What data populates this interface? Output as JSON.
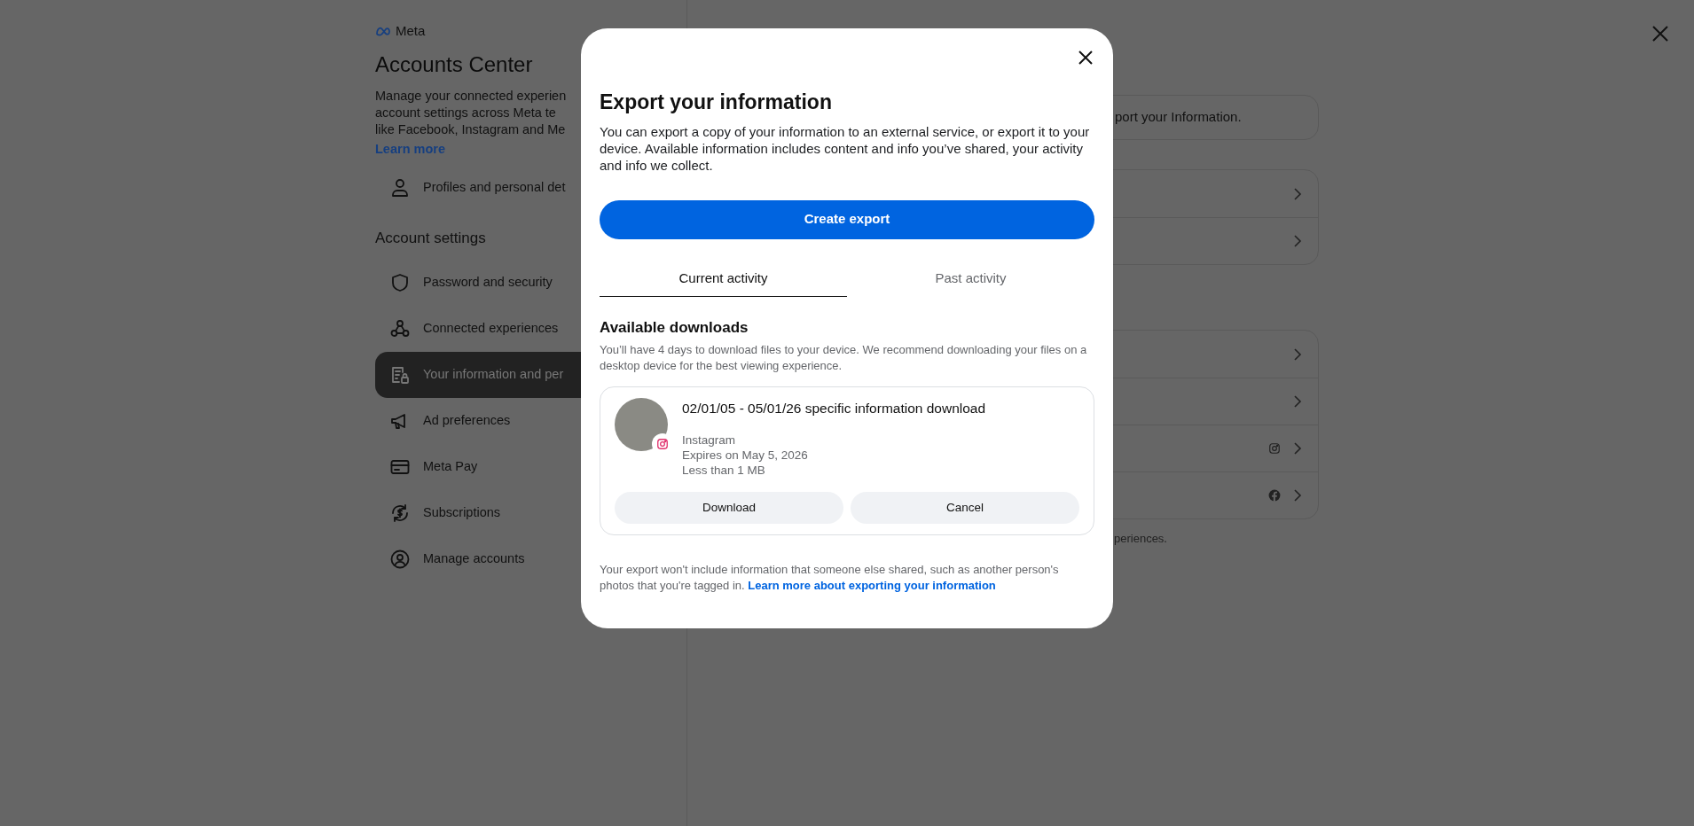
{
  "sidebar": {
    "logo_text": "Meta",
    "title": "Accounts Center",
    "description_lines": [
      "Manage your connected experien",
      "account settings across Meta te",
      "like Facebook, Instagram and Me"
    ],
    "learn_more": "Learn more",
    "top_items": [
      {
        "label": "Profiles and personal det",
        "selected": false
      }
    ],
    "section_title": "Account settings",
    "settings_items": [
      {
        "label": "Password and security",
        "selected": false
      },
      {
        "label": "Connected experiences",
        "selected": false
      },
      {
        "label": "Your information and per",
        "selected": true
      },
      {
        "label": "Ad preferences",
        "selected": false
      },
      {
        "label": "Meta Pay",
        "selected": false
      },
      {
        "label": "Subscriptions",
        "selected": false
      },
      {
        "label": "Manage accounts",
        "selected": false
      }
    ]
  },
  "background": {
    "notice_text": "port your Information.",
    "footer_text": "periences."
  },
  "modal": {
    "title": "Export your information",
    "description": "You can export a copy of your information to an external service, or export it to your device. Available information includes content and info you’ve shared, your activity and info we collect.",
    "create_button": "Create export",
    "tabs": [
      {
        "label": "Current activity",
        "selected": true
      },
      {
        "label": "Past activity",
        "selected": false
      }
    ],
    "downloads": {
      "title": "Available downloads",
      "description": "You’ll have 4 days to download files to your device. We recommend downloading your files on a desktop device for the best viewing experience.",
      "items": [
        {
          "title": "02/01/05 - 05/01/26 specific information download",
          "source": "Instagram",
          "expires": "Expires on May 5, 2026",
          "size": "Less than 1 MB",
          "download_button": "Download",
          "cancel_button": "Cancel"
        }
      ]
    },
    "footer_text": "Your export won't include information that someone else shared, such as another person's photos that you're tagged in.",
    "footer_link": "Learn more about exporting your information"
  }
}
